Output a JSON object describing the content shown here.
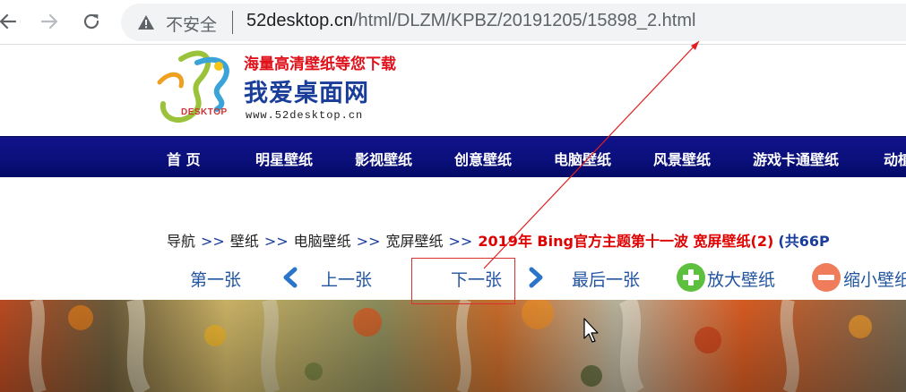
{
  "browser": {
    "back_icon": "arrow-left-icon",
    "forward_icon": "arrow-right-icon",
    "reload_icon": "reload-icon",
    "security_icon": "warning-triangle-icon",
    "security_label": "不安全",
    "url_host": "52desktop.cn",
    "url_path": "/html/DLZM/KPBZ/20191205/15898_2.html"
  },
  "logo": {
    "slogan": "海量高清壁纸等您下载",
    "name": "我爱桌面网",
    "url": "www.52desktop.cn",
    "mark_text": "52",
    "sub_text": "DESKTOP"
  },
  "nav": {
    "items": [
      {
        "label": "首  页"
      },
      {
        "label": "明星壁纸"
      },
      {
        "label": "影视壁纸"
      },
      {
        "label": "创意壁纸"
      },
      {
        "label": "电脑壁纸"
      },
      {
        "label": "风景壁纸"
      },
      {
        "label": "游戏卡通壁纸"
      },
      {
        "label": "动植"
      }
    ]
  },
  "breadcrumb": {
    "items": [
      "导航",
      "壁纸",
      "电脑壁纸",
      "宽屏壁纸"
    ],
    "separator": ">>",
    "title": "2019年 Bing官方主题第十一波 宽屏壁纸(2)",
    "count": "(共66P"
  },
  "pager": {
    "first": "第一张",
    "prev": "上一张",
    "next": "下一张",
    "last": "最后一张",
    "zoom_in": "放大壁纸",
    "zoom_out": "缩小壁纸",
    "prev_icon": "chevron-left-icon",
    "next_icon": "chevron-right-icon",
    "zoom_in_icon": "plus-circle-icon",
    "zoom_out_icon": "minus-circle-icon"
  },
  "colors": {
    "nav_bg": "#0a0f7a",
    "link": "#2255a0",
    "title_red": "#e00000",
    "annotation_red": "#d93030"
  }
}
